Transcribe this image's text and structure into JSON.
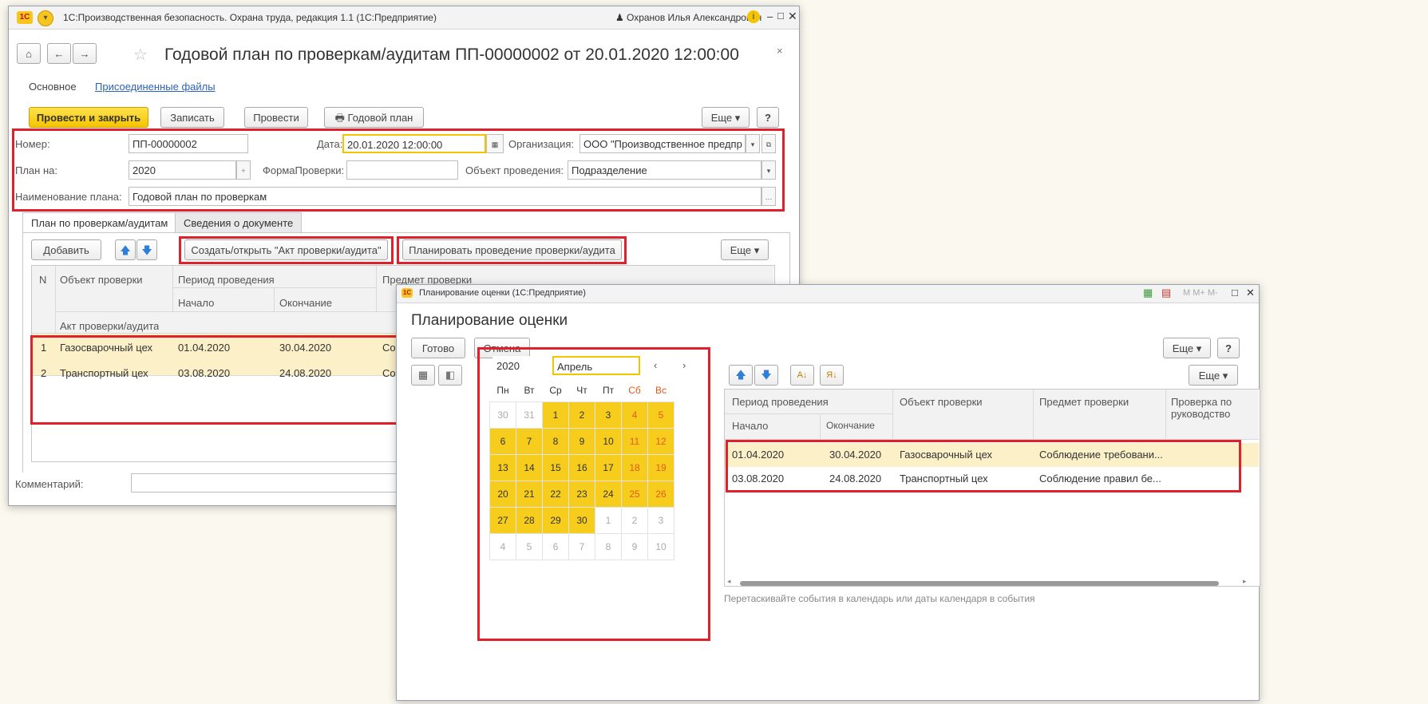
{
  "win1": {
    "title": "1С:Производственная безопасность. Охрана труда, редакция 1.1  (1С:Предприятие)",
    "user": "Охранов Илья Александрович",
    "doc_title": "Годовой план по проверкам/аудитам ПП-00000002 от 20.01.2020 12:00:00",
    "nav": {
      "main": "Основное",
      "files": "Присоединенные файлы"
    },
    "toolbar": {
      "post_close": "Провести и закрыть",
      "save": "Записать",
      "post": "Провести",
      "annual_plan": "Годовой план",
      "more": "Еще",
      "help": "?"
    },
    "form": {
      "number_label": "Номер:",
      "number": "ПП-00000002",
      "date_label": "Дата:",
      "date": "20.01.2020 12:00:00",
      "org_label": "Организация:",
      "org": "ООО \"Производственное предпр",
      "plan_for_label": "План на:",
      "plan_for": "2020",
      "check_form_label": "ФормаПроверки:",
      "check_form": "",
      "object_label": "Объект проведения:",
      "object": "Подразделение",
      "plan_name_label": "Наименование плана:",
      "plan_name": "Годовой план по проверкам"
    },
    "tabs": [
      "План по проверкам/аудитам",
      "Сведения о документе"
    ],
    "table_toolbar": {
      "add": "Добавить",
      "create_act": "Создать/открыть \"Акт проверки/аудита\"",
      "plan_check": "Планировать проведение проверки/аудита",
      "more": "Еще"
    },
    "table": {
      "headers": {
        "n": "N",
        "object": "Объект проверки",
        "period": "Период проведения",
        "subject": "Предмет проверки",
        "start": "Начало",
        "end": "Окончание",
        "act": "Акт проверки/аудита"
      },
      "rows": [
        {
          "n": "1",
          "object": "Газосварочный цех",
          "start": "01.04.2020",
          "end": "30.04.2020",
          "subject": "Соб"
        },
        {
          "n": "2",
          "object": "Транспортный цех",
          "start": "03.08.2020",
          "end": "24.08.2020",
          "subject": "Соб"
        }
      ]
    },
    "comment_label": "Комментарий:"
  },
  "win2": {
    "title": "Планирование оценки  (1С:Предприятие)",
    "heading": "Планирование оценки",
    "toolbar": {
      "done": "Готово",
      "cancel": "Отмена",
      "more": "Еще",
      "help": "?",
      "more2": "Еще"
    },
    "titlebar_icons": "M  M+  M-",
    "calendar": {
      "year": "2020",
      "month": "Апрель",
      "weekdays": [
        "Пн",
        "Вт",
        "Ср",
        "Чт",
        "Пт",
        "Сб",
        "Вс"
      ],
      "weeks": [
        [
          "30",
          "31",
          "1",
          "2",
          "3",
          "4",
          "5"
        ],
        [
          "6",
          "7",
          "8",
          "9",
          "10",
          "11",
          "12"
        ],
        [
          "13",
          "14",
          "15",
          "16",
          "17",
          "18",
          "19"
        ],
        [
          "20",
          "21",
          "22",
          "23",
          "24",
          "25",
          "26"
        ],
        [
          "27",
          "28",
          "29",
          "30",
          "1",
          "2",
          "3"
        ],
        [
          "4",
          "5",
          "6",
          "7",
          "8",
          "9",
          "10"
        ]
      ]
    },
    "table": {
      "headers": {
        "period": "Период проведения",
        "start": "Начало",
        "end": "Окончание",
        "object": "Объект проверки",
        "subject": "Предмет проверки",
        "management": "Проверка по руководство"
      },
      "rows": [
        {
          "start": "01.04.2020",
          "end": "30.04.2020",
          "object": "Газосварочный цех",
          "subject": "Соблюдение требовани..."
        },
        {
          "start": "03.08.2020",
          "end": "24.08.2020",
          "object": "Транспортный цех",
          "subject": "Соблюдение правил бе..."
        }
      ]
    },
    "hint": "Перетаскивайте события в календарь или даты календаря в события"
  },
  "colors": {
    "accent_yellow": "#f4c400",
    "highlight_red": "#e0202a",
    "link_blue": "#2a63b8"
  }
}
